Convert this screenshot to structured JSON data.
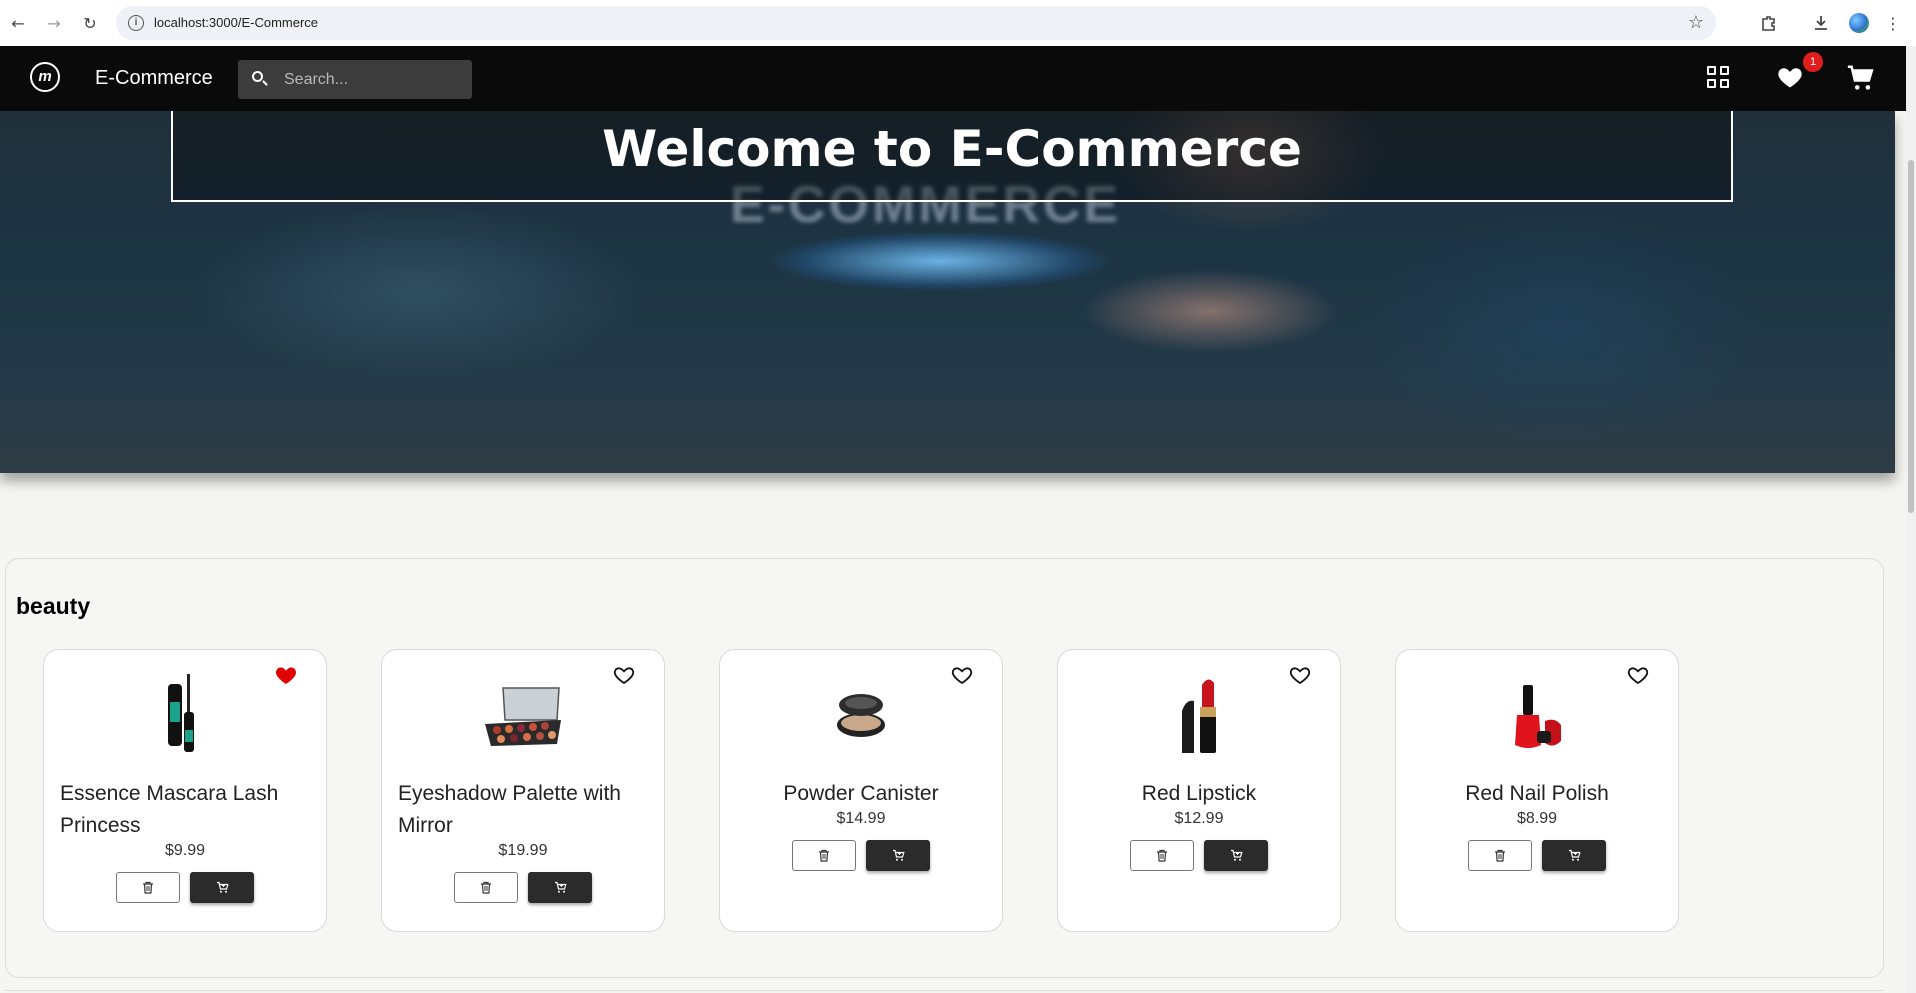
{
  "browser": {
    "url": "localhost:3000/E-Commerce",
    "back_icon": "arrow-left-icon",
    "forward_icon": "arrow-right-icon",
    "reload_icon": "reload-icon",
    "bookmark_icon": "star-icon"
  },
  "navbar": {
    "brand": "E-Commerce",
    "search_placeholder": "Search...",
    "wishlist_count": "1"
  },
  "hero": {
    "title": "Welcome to E-Commerce",
    "background_text": "E-COMMERCE"
  },
  "category": {
    "title": "beauty",
    "products": [
      {
        "name": "Essence Mascara Lash Princess",
        "price": "$9.99",
        "favorited": true,
        "image": "mascara"
      },
      {
        "name": "Eyeshadow Palette with Mirror",
        "price": "$19.99",
        "favorited": false,
        "image": "eyeshadow-palette"
      },
      {
        "name": "Powder Canister",
        "price": "$14.99",
        "favorited": false,
        "image": "powder-canister"
      },
      {
        "name": "Red Lipstick",
        "price": "$12.99",
        "favorited": false,
        "image": "lipstick"
      },
      {
        "name": "Red Nail Polish",
        "price": "$8.99",
        "favorited": false,
        "image": "nail-polish"
      }
    ]
  },
  "colors": {
    "navbar_bg": "#0a0a0a",
    "badge": "#e11d1d",
    "favorite_heart": "#e00000",
    "add_to_cart_button": "#2b2b2b"
  }
}
